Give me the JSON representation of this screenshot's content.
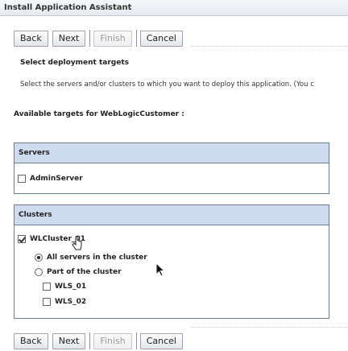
{
  "window": {
    "title": "Install Application Assistant"
  },
  "toolbar": {
    "back_label": "Back",
    "next_label": "Next",
    "finish_label": "Finish",
    "cancel_label": "Cancel"
  },
  "section": {
    "heading": "Select deployment targets",
    "description": "Select the servers and/or clusters to which you want to deploy this application. (You c",
    "available_label": "Available targets for WebLogicCustomer :"
  },
  "servers": {
    "header": "Servers",
    "items": [
      {
        "label": "AdminServer",
        "checked": false
      }
    ]
  },
  "clusters": {
    "header": "Clusters",
    "cluster": {
      "label": "WLCluster_01",
      "checked": true
    },
    "options": [
      {
        "label": "All servers in the cluster",
        "selected": true
      },
      {
        "label": "Part of the cluster",
        "selected": false
      }
    ],
    "members": [
      {
        "label": "WLS_01",
        "checked": false
      },
      {
        "label": "WLS_02",
        "checked": false
      }
    ]
  }
}
